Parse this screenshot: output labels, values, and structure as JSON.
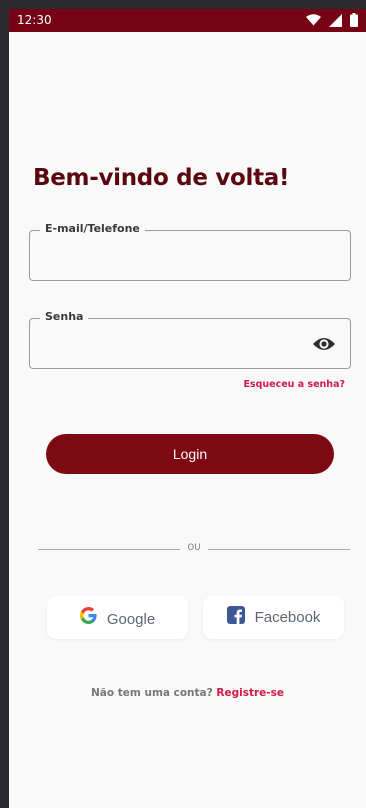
{
  "status_bar": {
    "time": "12:30",
    "icons": [
      "wifi-icon",
      "signal-icon",
      "battery-icon"
    ],
    "color": "#760313"
  },
  "header": {
    "title": "Bem-vindo de volta!"
  },
  "form": {
    "email": {
      "label": "E-mail/Telefone",
      "value": "",
      "placeholder": ""
    },
    "password": {
      "label": "Senha",
      "value": "",
      "placeholder": "",
      "toggle_icon": "eye-icon"
    },
    "forgot_password": "Esqueceu a senha?",
    "login_label": "Login"
  },
  "divider": {
    "text": "OU"
  },
  "social": {
    "google": {
      "label": "Google",
      "icon": "google-icon"
    },
    "facebook": {
      "label": "Facebook",
      "icon": "facebook-icon"
    }
  },
  "signup": {
    "question": "Não tem uma conta?",
    "link": "Registre-se"
  },
  "colors": {
    "primary": "#7d0913",
    "title": "#5a0710",
    "accent": "#d11a48",
    "background": "#f9f9fa"
  }
}
